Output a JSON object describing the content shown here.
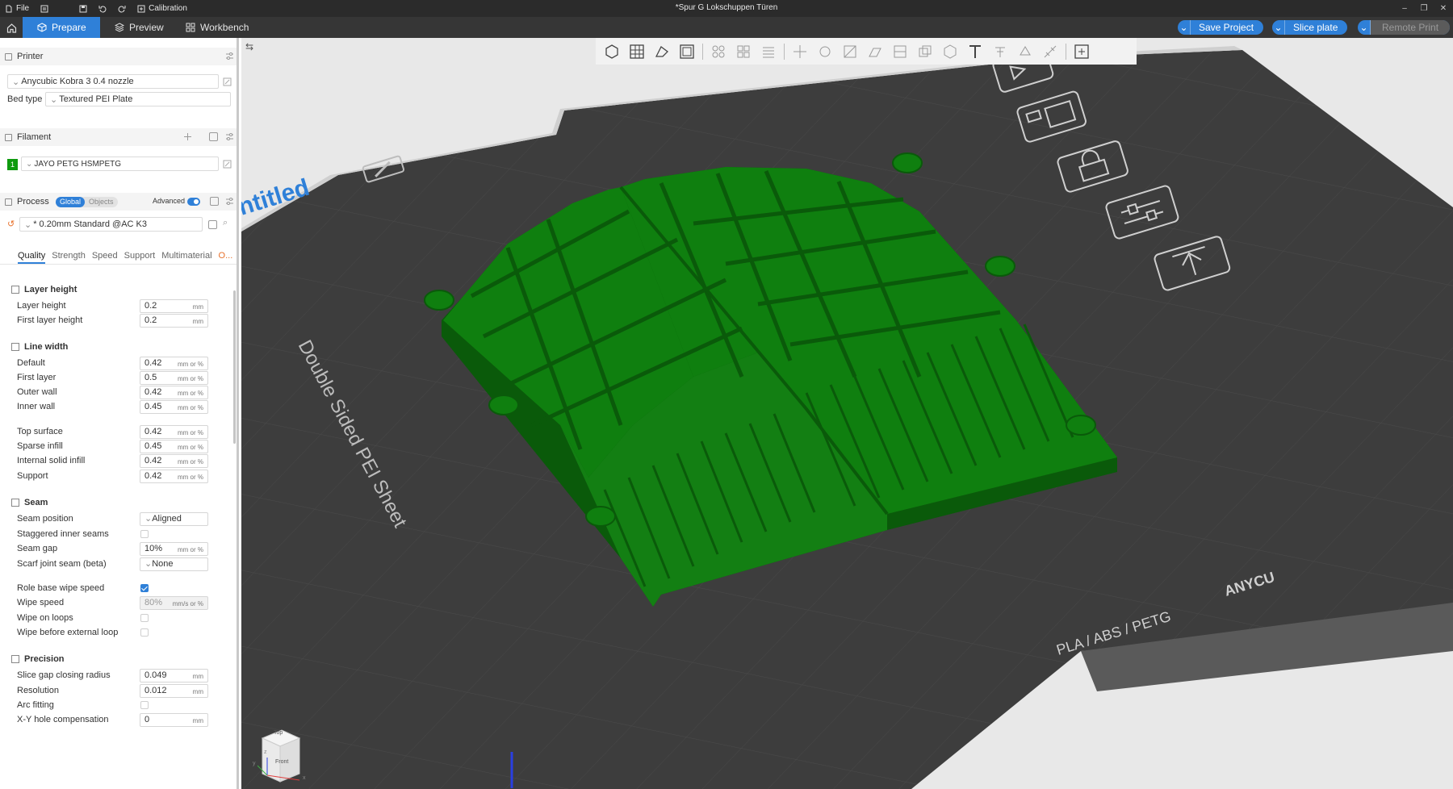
{
  "titlebar": {
    "file": "File",
    "calibration": "Calibration",
    "title": "*Spur G Lokschuppen Türen"
  },
  "topbar": {
    "prepare": "Prepare",
    "preview": "Preview",
    "workbench": "Workbench",
    "save_project": "Save Project",
    "slice_plate": "Slice plate",
    "remote_print": "Remote Print"
  },
  "printer": {
    "title": "Printer",
    "preset": "Anycubic Kobra 3 0.4 nozzle",
    "bed_type_label": "Bed type",
    "bed_type": "Textured PEI Plate"
  },
  "filament": {
    "title": "Filament",
    "slot": "1",
    "name": "JAYO PETG HSMPETG",
    "color": "#0f9a0f"
  },
  "process": {
    "title": "Process",
    "global": "Global",
    "objects": "Objects",
    "advanced": "Advanced",
    "preset": "* 0.20mm Standard @AC K3"
  },
  "tabs": {
    "quality": "Quality",
    "strength": "Strength",
    "speed": "Speed",
    "support": "Support",
    "multimaterial": "Multimaterial",
    "others": "O..."
  },
  "layer_height": {
    "title": "Layer height",
    "layer_height_label": "Layer height",
    "layer_height": "0.2",
    "first_layer_height_label": "First layer height",
    "first_layer_height": "0.2",
    "unit": "mm"
  },
  "line_width": {
    "title": "Line width",
    "unit": "mm or %",
    "rows": [
      {
        "label": "Default",
        "value": "0.42"
      },
      {
        "label": "First layer",
        "value": "0.5"
      },
      {
        "label": "Outer wall",
        "value": "0.42"
      },
      {
        "label": "Inner wall",
        "value": "0.45"
      },
      {
        "label": "Top surface",
        "value": "0.42"
      },
      {
        "label": "Sparse infill",
        "value": "0.45"
      },
      {
        "label": "Internal solid infill",
        "value": "0.42"
      },
      {
        "label": "Support",
        "value": "0.42"
      }
    ]
  },
  "seam": {
    "title": "Seam",
    "seam_position_label": "Seam position",
    "seam_position": "Aligned",
    "staggered_label": "Staggered inner seams",
    "staggered": false,
    "seam_gap_label": "Seam gap",
    "seam_gap": "10%",
    "seam_gap_unit": "mm or %",
    "scarf_label": "Scarf joint seam (beta)",
    "scarf": "None",
    "role_wipe_label": "Role base wipe speed",
    "role_wipe": true,
    "wipe_speed_label": "Wipe speed",
    "wipe_speed": "80%",
    "wipe_speed_unit": "mm/s or %",
    "wipe_loops_label": "Wipe on loops",
    "wipe_loops": false,
    "wipe_before_label": "Wipe before external loop",
    "wipe_before": false
  },
  "precision": {
    "title": "Precision",
    "slice_gap_label": "Slice gap closing radius",
    "slice_gap": "0.049",
    "resolution_label": "Resolution",
    "resolution": "0.012",
    "arc_label": "Arc fitting",
    "arc": false,
    "xy_hole_label": "X-Y hole compensation",
    "xy_hole": "0",
    "unit": "mm"
  },
  "plate": {
    "label_name": "ntitled",
    "sheet_label": "Double Sided PEI Sheet",
    "material_label": "PLA / ABS / PETG",
    "brand_label": "ANYCU"
  },
  "nav_cube": {
    "top": "Top",
    "front": "Front",
    "x": "x",
    "y": "y",
    "z": "z"
  },
  "colors": {
    "accent": "#2f80d8",
    "model": "#0f7f0f",
    "bed": "#3d3d3d"
  }
}
